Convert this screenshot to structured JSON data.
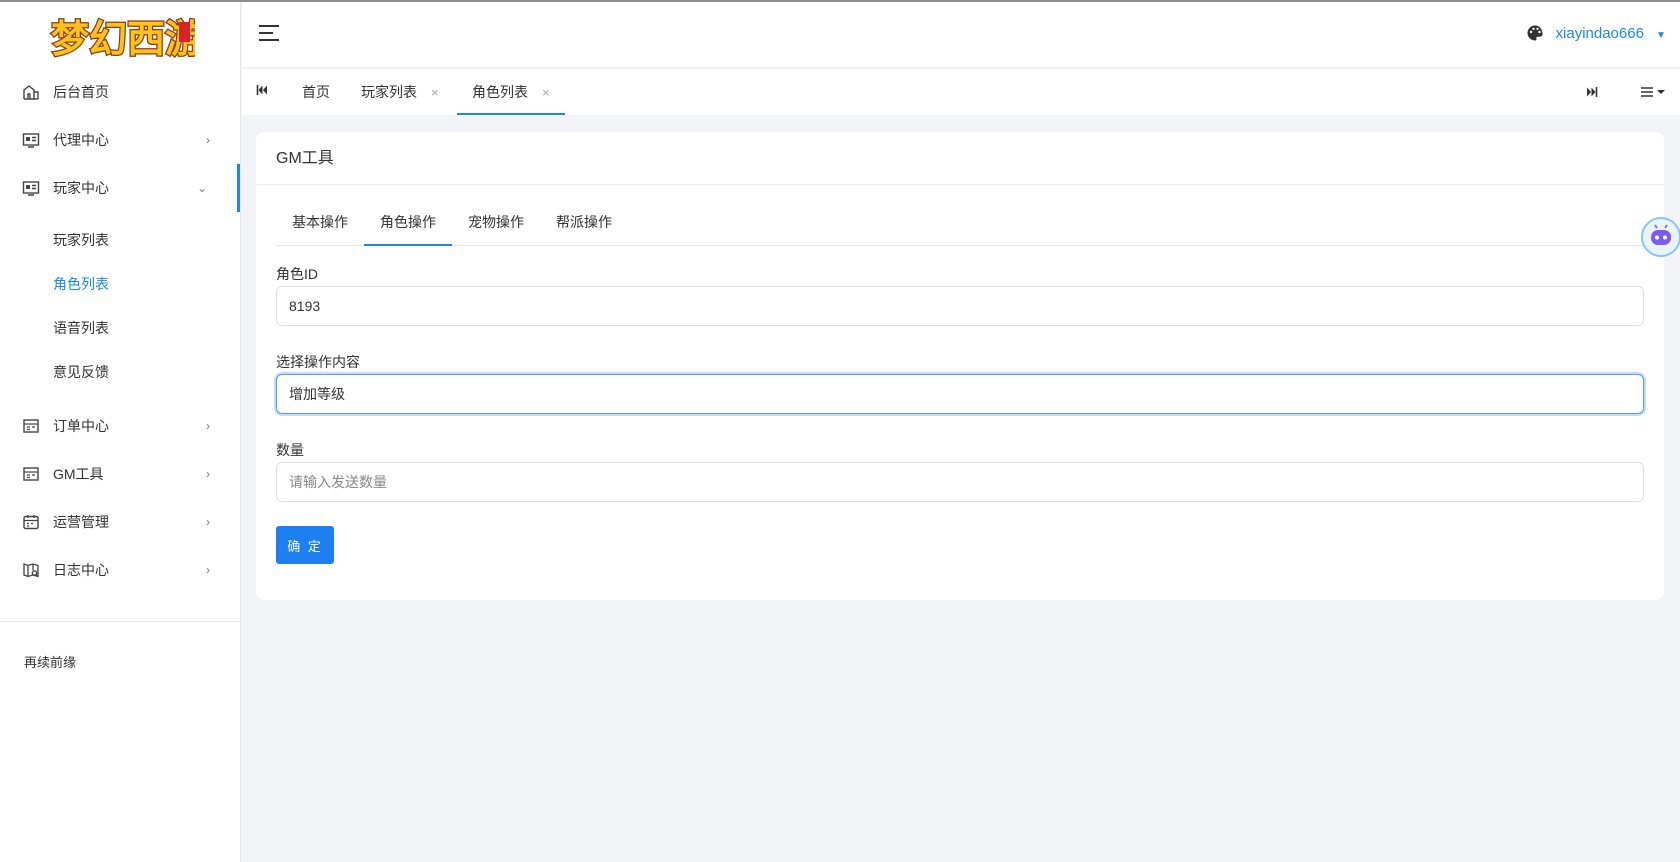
{
  "logo": {
    "text": "梦幻西游",
    "stamp": "手游"
  },
  "sidebar": {
    "items": [
      {
        "label": "后台首页",
        "icon": "home-icon"
      },
      {
        "label": "代理中心",
        "icon": "agent-icon"
      },
      {
        "label": "玩家中心",
        "icon": "player-icon"
      },
      {
        "label": "订单中心",
        "icon": "order-icon"
      },
      {
        "label": "GM工具",
        "icon": "gm-icon"
      },
      {
        "label": "运营管理",
        "icon": "calendar-icon"
      },
      {
        "label": "日志中心",
        "icon": "log-icon"
      }
    ],
    "submenu": [
      {
        "label": "玩家列表"
      },
      {
        "label": "角色列表"
      },
      {
        "label": "语音列表"
      },
      {
        "label": "意见反馈"
      }
    ],
    "footer": "再续前缘"
  },
  "header": {
    "username": "xiayindao666"
  },
  "tabs": [
    {
      "label": "首页"
    },
    {
      "label": "玩家列表"
    },
    {
      "label": "角色列表"
    }
  ],
  "card": {
    "title": "GM工具",
    "op_tabs": [
      "基本操作",
      "角色操作",
      "宠物操作",
      "帮派操作"
    ],
    "role_id": {
      "label": "角色ID",
      "value": "8193"
    },
    "operation": {
      "label": "选择操作内容",
      "value": "增加等级"
    },
    "quantity": {
      "label": "数量",
      "placeholder": "请输入发送数量"
    },
    "confirm_label": "确 定"
  },
  "colors": {
    "accent": "#1e88e5",
    "background": "#f3f4f8",
    "button": "#1e7ff0"
  }
}
